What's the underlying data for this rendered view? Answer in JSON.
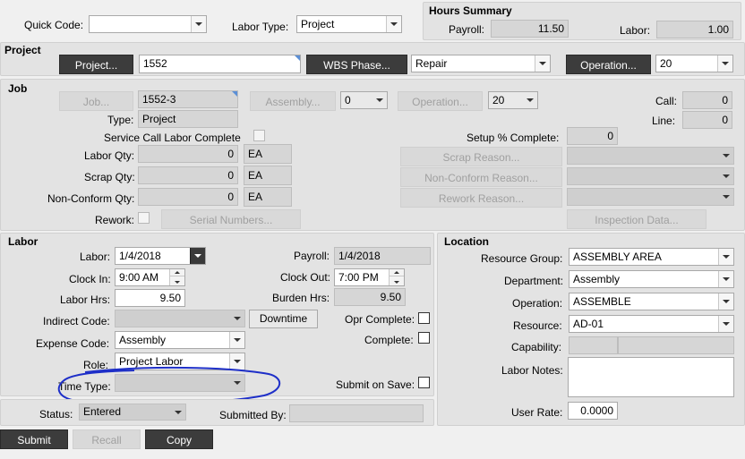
{
  "top": {
    "quick_code_label": "Quick Code:",
    "quick_code_value": "",
    "labor_type_label": "Labor Type:",
    "labor_type_value": "Project"
  },
  "hours_summary": {
    "title": "Hours Summary",
    "payroll_label": "Payroll:",
    "payroll_value": "11.50",
    "labor_label": "Labor:",
    "labor_value": "1.00"
  },
  "project": {
    "title": "Project",
    "project_button": "Project...",
    "project_value": "1552",
    "wbs_button": "WBS Phase...",
    "wbs_value": "Repair",
    "operation_button": "Operation...",
    "operation_value": "20"
  },
  "job": {
    "title": "Job",
    "job_button": "Job...",
    "job_value": "1552-3",
    "assembly_button": "Assembly...",
    "assembly_value": "0",
    "operation_button": "Operation...",
    "operation_value": "20",
    "call_label": "Call:",
    "call_value": "0",
    "line_label": "Line:",
    "line_value": "0",
    "type_label": "Type:",
    "type_value": "Project",
    "service_call_label": "Service Call Labor Complete",
    "setup_label": "Setup % Complete:",
    "setup_value": "0",
    "labor_qty_label": "Labor Qty:",
    "labor_qty_value": "0",
    "labor_qty_uom": "EA",
    "scrap_qty_label": "Scrap Qty:",
    "scrap_qty_value": "0",
    "scrap_qty_uom": "EA",
    "nonconform_qty_label": "Non-Conform Qty:",
    "nonconform_qty_value": "0",
    "nonconform_qty_uom": "EA",
    "scrap_reason_button": "Scrap Reason...",
    "nonconform_reason_button": "Non-Conform Reason...",
    "rework_reason_button": "Rework Reason...",
    "rework_label": "Rework:",
    "serial_numbers_button": "Serial Numbers...",
    "inspection_button": "Inspection Data..."
  },
  "labor": {
    "title": "Labor",
    "labor_label": "Labor:",
    "labor_date": "1/4/2018",
    "payroll_label": "Payroll:",
    "payroll_date": "1/4/2018",
    "clock_in_label": "Clock In:",
    "clock_in_value": "9:00 AM",
    "clock_out_label": "Clock Out:",
    "clock_out_value": "7:00 PM",
    "labor_hrs_label": "Labor Hrs:",
    "labor_hrs_value": "9.50",
    "burden_hrs_label": "Burden Hrs:",
    "burden_hrs_value": "9.50",
    "indirect_code_label": "Indirect Code:",
    "indirect_code_value": "",
    "downtime_button": "Downtime",
    "opr_complete_label": "Opr Complete:",
    "expense_code_label": "Expense Code:",
    "expense_code_value": "Assembly",
    "complete_label": "Complete:",
    "role_label": "Role:",
    "role_value": "Project Labor",
    "time_type_label": "Time Type:",
    "time_type_value": "",
    "submit_on_save_label": "Submit on Save:"
  },
  "location": {
    "title": "Location",
    "resource_group_label": "Resource Group:",
    "resource_group_value": "ASSEMBLY AREA",
    "department_label": "Department:",
    "department_value": "Assembly",
    "operation_label": "Operation:",
    "operation_value": "ASSEMBLE",
    "resource_label": "Resource:",
    "resource_value": "AD-01",
    "capability_label": "Capability:",
    "labor_notes_label": "Labor Notes:",
    "user_rate_label": "User Rate:",
    "user_rate_value": "0.0000"
  },
  "status": {
    "status_label": "Status:",
    "status_value": "Entered",
    "submitted_by_label": "Submitted By:",
    "submitted_by_value": ""
  },
  "footer": {
    "submit_button": "Submit",
    "recall_button": "Recall",
    "copy_button": "Copy"
  },
  "colors": {
    "annotation_circle": "#1e2fc8",
    "dark_button": "#3c3c3c"
  }
}
